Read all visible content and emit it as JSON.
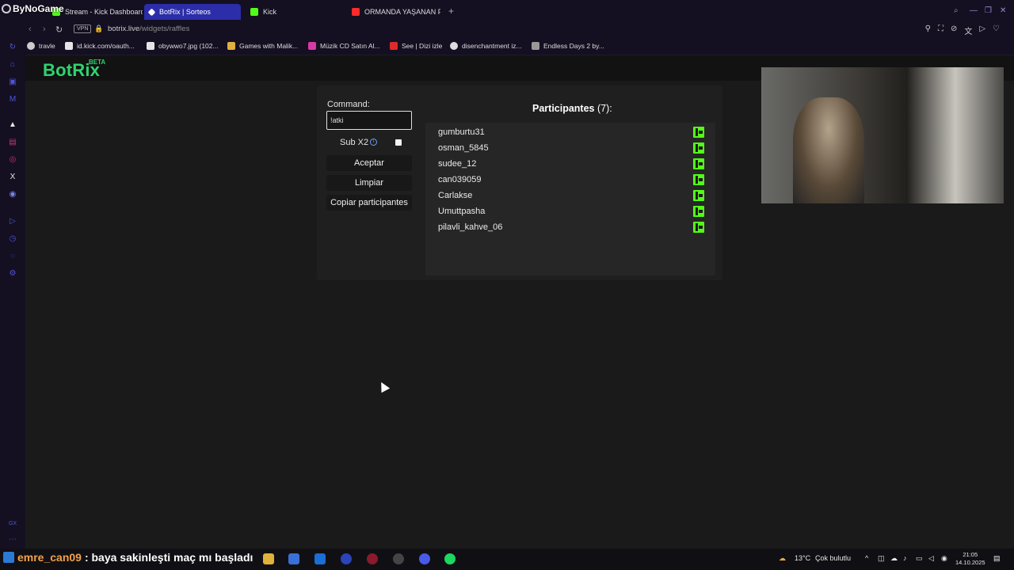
{
  "overlay": {
    "title": "ByNoGame"
  },
  "tabs": [
    {
      "label": "Stream - Kick Dashboard",
      "favicon_color": "#53fc18"
    },
    {
      "label": "BotRix | Sorteos",
      "favicon_color": "#ffffff",
      "active": true
    },
    {
      "label": "Kick",
      "favicon_color": "#53fc18"
    },
    {
      "label": "ORMANDA YAŞANAN PA",
      "favicon_color": "#ff2a2a"
    }
  ],
  "address": {
    "vpn_label": "VPN",
    "host": "botrix.live",
    "path": "/widgets/raffles"
  },
  "bookmarks": [
    {
      "label": "travle",
      "favicon_color": "#cccccc"
    },
    {
      "label": "id.kick.com/oauth...",
      "favicon_color": "#e5e5e5"
    },
    {
      "label": "obywwo7.jpg (102...",
      "favicon_color": "#e5e5e5"
    },
    {
      "label": "Games with Malik...",
      "favicon_color": "#e0b040"
    },
    {
      "label": "Müzik CD Satın Al...",
      "favicon_color": "#d63aa5"
    },
    {
      "label": "See | Dizi izle",
      "favicon_color": "#e02a2a"
    },
    {
      "label": "disenchantment iz...",
      "favicon_color": "#dddddd"
    },
    {
      "label": "Endless Days 2 by...",
      "favicon_color": "#999999"
    }
  ],
  "brand": {
    "name": "BotRix",
    "badge": "BETA",
    "color": "#2fd46f"
  },
  "raffle": {
    "command_label": "Command:",
    "command_value": "!atki",
    "sub_label": "Sub X2",
    "accept_label": "Aceptar",
    "clear_label": "Limpiar",
    "copy_label": "Copiar participantes",
    "participants_title": "Participantes",
    "participants_count": "(7):",
    "participants": [
      {
        "name": "gumburtu31"
      },
      {
        "name": "osman_5845"
      },
      {
        "name": "sudee_12"
      },
      {
        "name": "can039059"
      },
      {
        "name": "Carlakse"
      },
      {
        "name": "Umuttpasha"
      },
      {
        "name": "pilavli_kahve_06"
      }
    ],
    "platform_icon": "kick-icon",
    "platform_color": "#53fc18"
  },
  "chat_overlay": {
    "user": "emre_can09",
    "message": ": baya sakinleşti maç mı başladı"
  },
  "taskbar": {
    "weather": "13°C",
    "weather_desc": "Çok bulutlu",
    "time": "21:05",
    "date": "14.10.2025"
  }
}
